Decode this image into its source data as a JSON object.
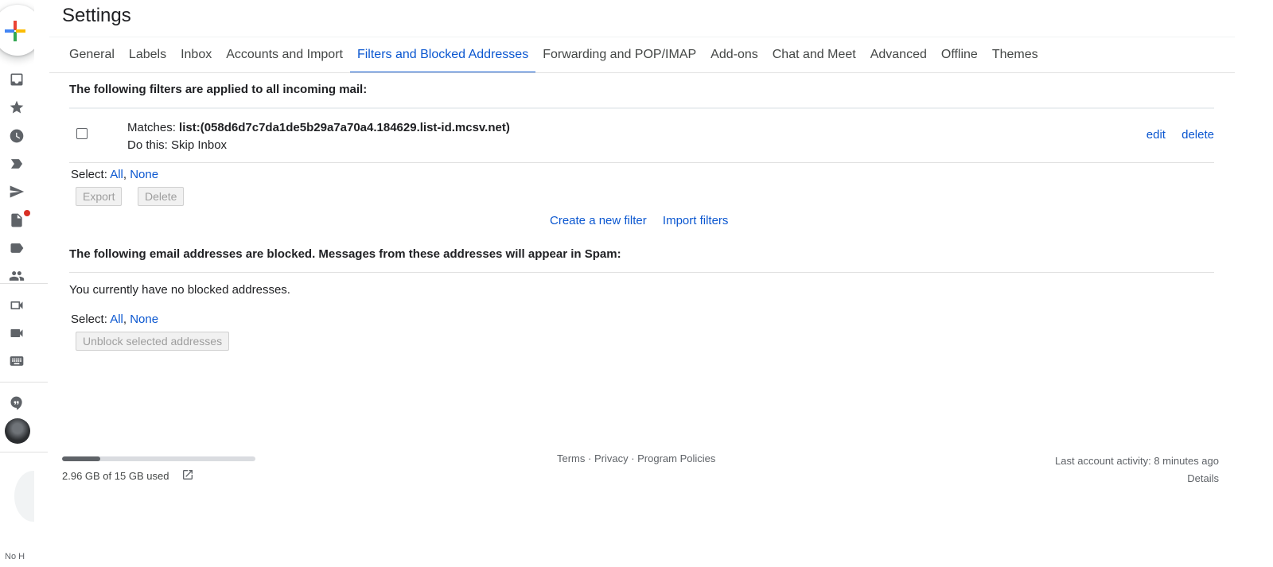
{
  "header": {
    "title": "Settings"
  },
  "tabs": [
    {
      "label": "General",
      "active": false
    },
    {
      "label": "Labels",
      "active": false
    },
    {
      "label": "Inbox",
      "active": false
    },
    {
      "label": "Accounts and Import",
      "active": false
    },
    {
      "label": "Filters and Blocked Addresses",
      "active": true
    },
    {
      "label": "Forwarding and POP/IMAP",
      "active": false
    },
    {
      "label": "Add-ons",
      "active": false
    },
    {
      "label": "Chat and Meet",
      "active": false
    },
    {
      "label": "Advanced",
      "active": false
    },
    {
      "label": "Offline",
      "active": false
    },
    {
      "label": "Themes",
      "active": false
    }
  ],
  "filters": {
    "heading": "The following filters are applied to all incoming mail:",
    "row": {
      "matches_label": "Matches:",
      "matches_value": "list:(058d6d7c7da1de5b29a7a70a4.184629.list-id.mcsv.net)",
      "action": "Do this: Skip Inbox",
      "edit": "edit",
      "delete": "delete"
    },
    "select": {
      "label": "Select:",
      "all": "All",
      "sep": ",",
      "none": "None"
    },
    "export_button": "Export",
    "delete_button": "Delete",
    "create_link": "Create a new filter",
    "import_link": "Import filters"
  },
  "blocked": {
    "heading": "The following email addresses are blocked. Messages from these addresses will appear in Spam:",
    "empty_text": "You currently have no blocked addresses.",
    "select": {
      "label": "Select:",
      "all": "All",
      "sep": ",",
      "none": "None"
    },
    "unblock_button": "Unblock selected addresses"
  },
  "footer": {
    "storage_text": "2.96 GB of 15 GB used",
    "storage_fraction": 0.197,
    "terms": "Terms",
    "dot": " · ",
    "privacy": "Privacy",
    "policies": "Program Policies",
    "activity": "Last account activity: 8 minutes ago",
    "details": "Details"
  },
  "rail": {
    "icons": [
      "compose-icon",
      "inbox-icon",
      "starred-icon",
      "snoozed-icon",
      "important-icon",
      "sent-icon",
      "drafts-icon",
      "label-icon",
      "contacts-icon",
      "new-meeting-icon",
      "join-meeting-icon",
      "keyboard-icon",
      "hangouts-icon"
    ],
    "tiny_text": "No H"
  },
  "colors": {
    "accent": "#0b57d0",
    "text": "#202124",
    "muted": "#5f6368",
    "notification_dot": "#d93025"
  }
}
